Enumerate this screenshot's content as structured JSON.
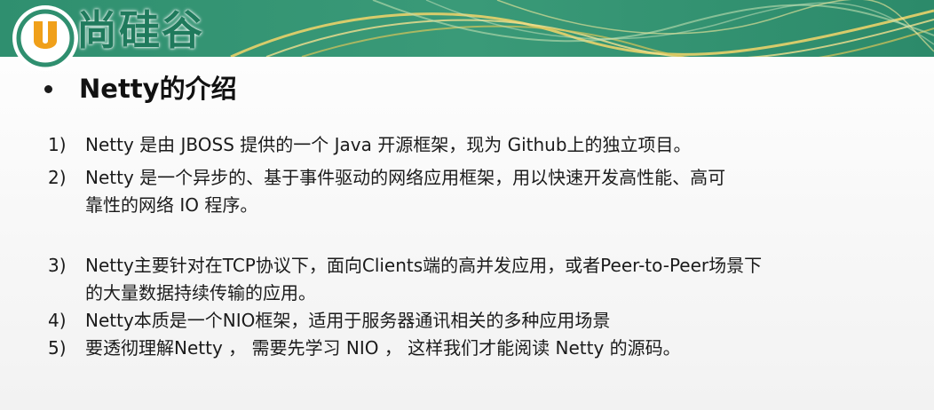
{
  "brand": {
    "logo_letter": "U",
    "name": "尚硅谷",
    "colors": {
      "green": "#1f7a5c",
      "orange": "#f0a01a",
      "banner_teal": "#2f8f6f"
    }
  },
  "slide": {
    "title": "Netty的介绍",
    "items": [
      {
        "num": "1)",
        "lines": [
          "Netty 是由 JBOSS 提供的一个 Java 开源框架，现为 Github上的独立项目。"
        ]
      },
      {
        "num": "2)",
        "lines": [
          "Netty 是一个异步的、基于事件驱动的网络应用框架，用以快速开发高性能、高可",
          "靠性的网络 IO 程序。"
        ]
      },
      {
        "num": "3)",
        "lines": [
          "Netty主要针对在TCP协议下，面向Clients端的高并发应用，或者Peer-to-Peer场景下",
          "的大量数据持续传输的应用。"
        ]
      },
      {
        "num": "4)",
        "lines": [
          "Netty本质是一个NIO框架，适用于服务器通讯相关的多种应用场景"
        ]
      },
      {
        "num": "5)",
        "lines": [
          "要透彻理解Netty ， 需要先学习 NIO ， 这样我们才能阅读 Netty 的源码。"
        ]
      }
    ]
  }
}
